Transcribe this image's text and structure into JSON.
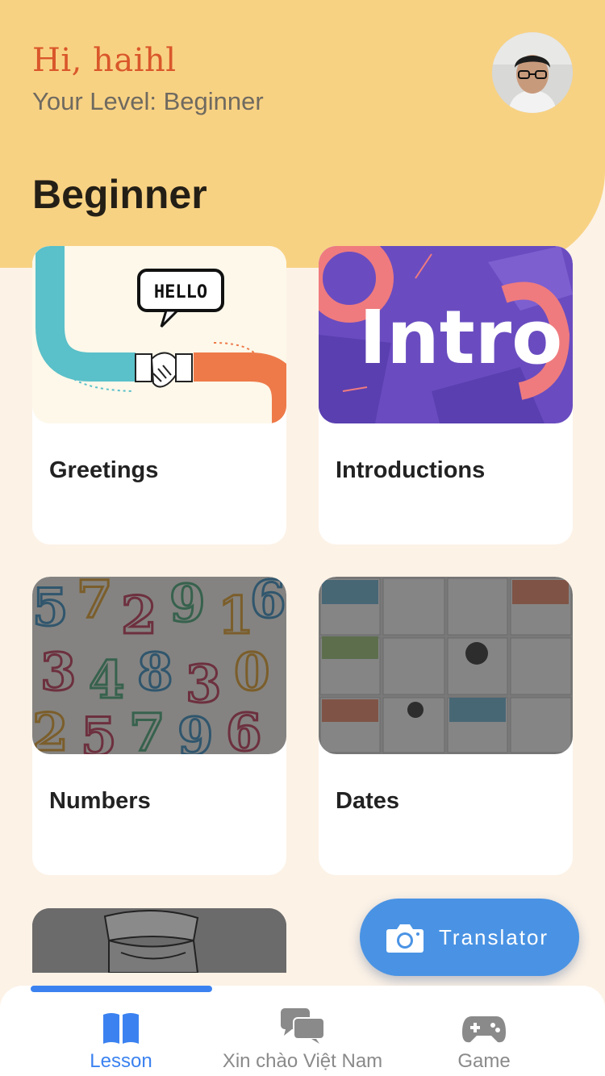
{
  "header": {
    "greeting": "Hi, haihl",
    "level_text": "Your Level: Beginner"
  },
  "section": {
    "title": "Beginner"
  },
  "lessons": [
    {
      "label": "Greetings",
      "locked": false,
      "thumb_text": "HELLO"
    },
    {
      "label": "Introductions",
      "locked": false,
      "thumb_text": "Intro"
    },
    {
      "label": "Numbers",
      "locked": true
    },
    {
      "label": "Dates",
      "locked": true
    }
  ],
  "partial_lesson": {
    "locked": true
  },
  "fab": {
    "label": "Translator",
    "icon": "camera-icon"
  },
  "tabs": [
    {
      "label": "Lesson",
      "icon": "book-icon",
      "active": true
    },
    {
      "label": "Xin chào Việt Nam",
      "icon": "chat-bubbles-icon",
      "active": false
    },
    {
      "label": "Game",
      "icon": "gamepad-icon",
      "active": false
    }
  ],
  "colors": {
    "header_bg": "#f8d283",
    "page_bg": "#fcf2e6",
    "greeting": "#d9572b",
    "accent_blue": "#3b82f0",
    "fab_blue": "#4a93e4"
  }
}
